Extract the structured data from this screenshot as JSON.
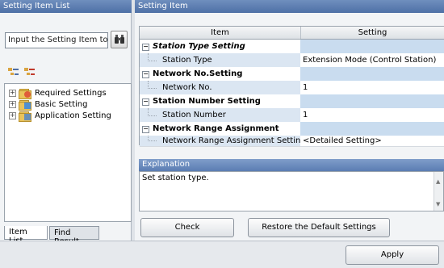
{
  "left_panel": {
    "title": "Setting Item List",
    "search_placeholder": "Input the Setting Item to S",
    "tree": [
      {
        "label": "Required Settings",
        "expander": "+"
      },
      {
        "label": "Basic Setting",
        "expander": "+"
      },
      {
        "label": "Application Setting",
        "expander": "+"
      }
    ],
    "tabs": [
      "Item List",
      "Find Result"
    ]
  },
  "right_panel": {
    "title": "Setting Item",
    "grid_headers": [
      "Item",
      "Setting"
    ],
    "rows": [
      {
        "type": "section",
        "item": "Station Type Setting",
        "setting": "",
        "italic": true
      },
      {
        "type": "item",
        "item": "Station Type",
        "setting": "Extension Mode (Control Station)"
      },
      {
        "type": "section",
        "item": "Network No.Setting",
        "setting": ""
      },
      {
        "type": "item",
        "item": "Network No.",
        "setting": "1"
      },
      {
        "type": "section",
        "item": "Station Number Setting",
        "setting": ""
      },
      {
        "type": "item",
        "item": "Station Number",
        "setting": "1"
      },
      {
        "type": "section",
        "item": "Network Range Assignment",
        "setting": ""
      },
      {
        "type": "item",
        "item": "Network Range Assignment Setting",
        "setting": "<Detailed Setting>"
      }
    ],
    "explanation_title": "Explanation",
    "explanation_text": "Set station type.",
    "check_label": "Check",
    "restore_label": "Restore the Default Settings",
    "apply_label": "Apply"
  },
  "colors": {
    "header_blue": "#5b7db2",
    "section_setting": "#c9dcef",
    "item_cell": "#dbe6f2"
  }
}
